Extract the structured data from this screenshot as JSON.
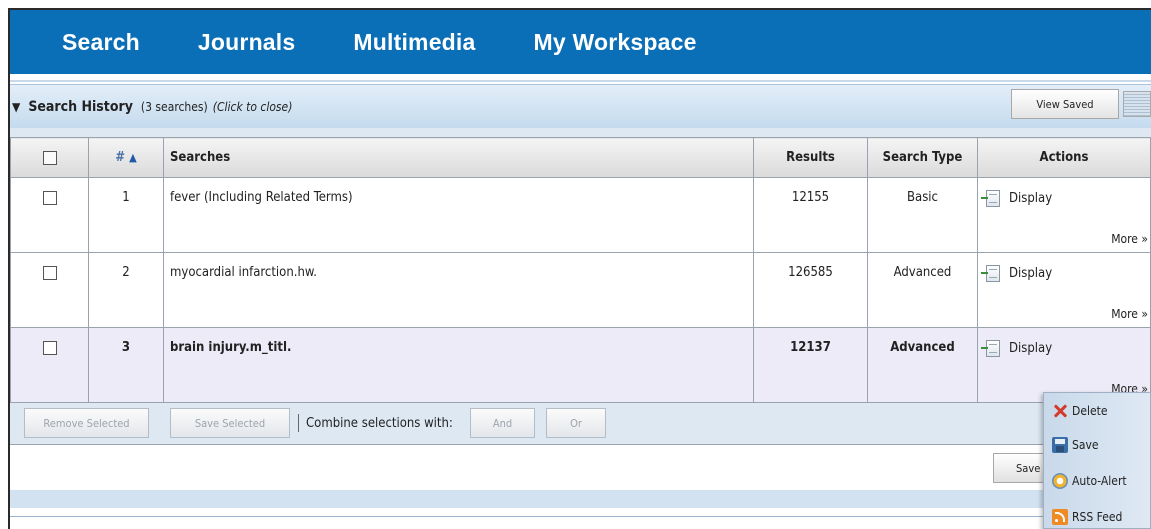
{
  "nav": {
    "items": [
      "Search",
      "Journals",
      "Multimedia",
      "My Workspace"
    ]
  },
  "history": {
    "title": "Search History",
    "count": "(3 searches)",
    "hint": "(Click to close)",
    "toggle_glyph": "▼",
    "view_saved_label": "View Saved"
  },
  "table": {
    "headers": {
      "number": "#",
      "sort_glyph": "▲",
      "searches": "Searches",
      "results": "Results",
      "search_type": "Search Type",
      "actions": "Actions"
    },
    "rows": [
      {
        "number": "1",
        "query": "fever (Including Related Terms)",
        "results": "12155",
        "type": "Basic",
        "display": "Display",
        "more": "More »",
        "highlighted": false
      },
      {
        "number": "2",
        "query": "myocardial infarction.hw.",
        "results": "126585",
        "type": "Advanced",
        "display": "Display",
        "more": "More »",
        "highlighted": false
      },
      {
        "number": "3",
        "query": "brain injury.m_titl.",
        "results": "12137",
        "type": "Advanced",
        "display": "Display",
        "more": "More »",
        "highlighted": true
      }
    ]
  },
  "toolbar": {
    "remove_selected": "Remove Selected",
    "save_selected": "Save Selected",
    "combine_label": "Combine selections with:",
    "and_label": "And",
    "or_label": "Or",
    "save_history": "Save Search History"
  },
  "popup_menu": {
    "items": [
      {
        "label": "Delete",
        "icon": "delete-icon"
      },
      {
        "label": "Save",
        "icon": "save-icon"
      },
      {
        "label": "Auto-Alert",
        "icon": "auto-alert-icon"
      },
      {
        "label": "RSS Feed",
        "icon": "rss-feed-icon"
      }
    ]
  },
  "colors": {
    "nav_bg": "#0b6fb8",
    "panel_bg": "#dde8f3",
    "highlight_row": "#ecebf7"
  }
}
